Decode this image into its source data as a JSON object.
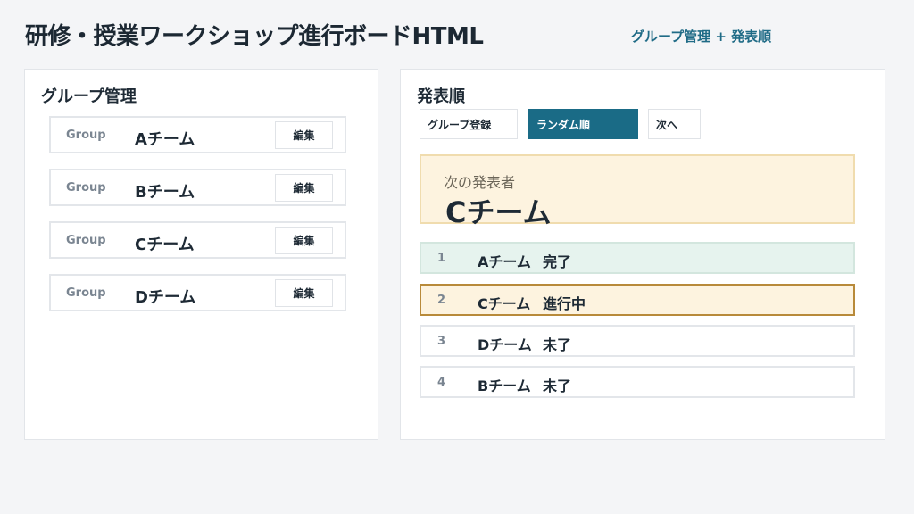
{
  "header": {
    "title": "研修・授業ワークショップ進行ボードHTML",
    "subtitle": "グループ管理 + 発表順"
  },
  "group_panel": {
    "title": "グループ管理",
    "groups": [
      {
        "tag": "Group",
        "name": "Aチーム",
        "edit_label": "編集"
      },
      {
        "tag": "Group",
        "name": "Bチーム",
        "edit_label": "編集"
      },
      {
        "tag": "Group",
        "name": "Cチーム",
        "edit_label": "編集"
      },
      {
        "tag": "Group",
        "name": "Dチーム",
        "edit_label": "編集"
      }
    ]
  },
  "order_panel": {
    "title": "発表順",
    "buttons": {
      "register": "グループ登録",
      "random": "ランダム順",
      "next": "次へ"
    },
    "next_presenter": {
      "label": "次の発表者",
      "team": "Cチーム"
    },
    "order": [
      {
        "num": "1",
        "team": "Aチーム",
        "status": "完了",
        "state": "done"
      },
      {
        "num": "2",
        "team": "Cチーム",
        "status": "進行中",
        "state": "current"
      },
      {
        "num": "3",
        "team": "Dチーム",
        "status": "未了",
        "state": "pending"
      },
      {
        "num": "4",
        "team": "Bチーム",
        "status": "未了",
        "state": "pending"
      }
    ]
  },
  "colors": {
    "accent": "#1a6b86",
    "highlight_bg": "#fdf3df",
    "done_bg": "#e6f3ee",
    "current_border": "#b88a3a"
  }
}
